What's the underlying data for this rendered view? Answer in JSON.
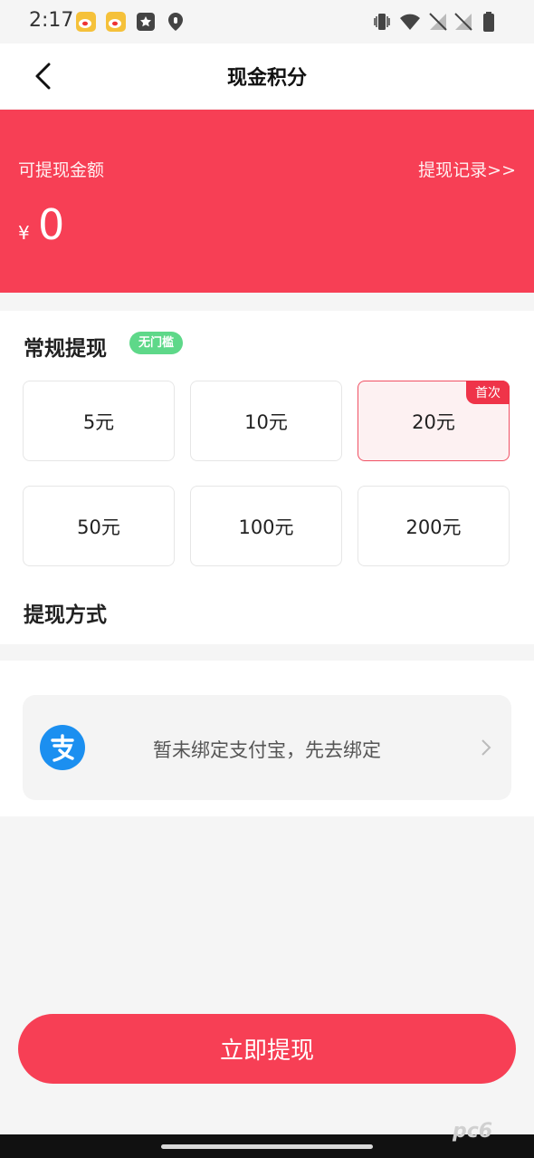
{
  "status": {
    "time": "2:17"
  },
  "header": {
    "title": "现金积分"
  },
  "balance": {
    "label": "可提现金额",
    "records_link": "提现记录>>",
    "currency": "¥",
    "amount": "0"
  },
  "regular": {
    "title": "常规提现",
    "tag": "无门槛",
    "options": [
      "5元",
      "10元",
      "20元",
      "50元",
      "100元",
      "200元"
    ],
    "selected_badge": "首次"
  },
  "method": {
    "title": "提现方式",
    "alipay_text": "暂未绑定支付宝，先去绑定"
  },
  "submit_label": "立即提现",
  "watermark": "pc6",
  "colors": {
    "primary": "#f73f55",
    "tag_green": "#5ed889",
    "alipay_blue": "#1b8ff0"
  }
}
